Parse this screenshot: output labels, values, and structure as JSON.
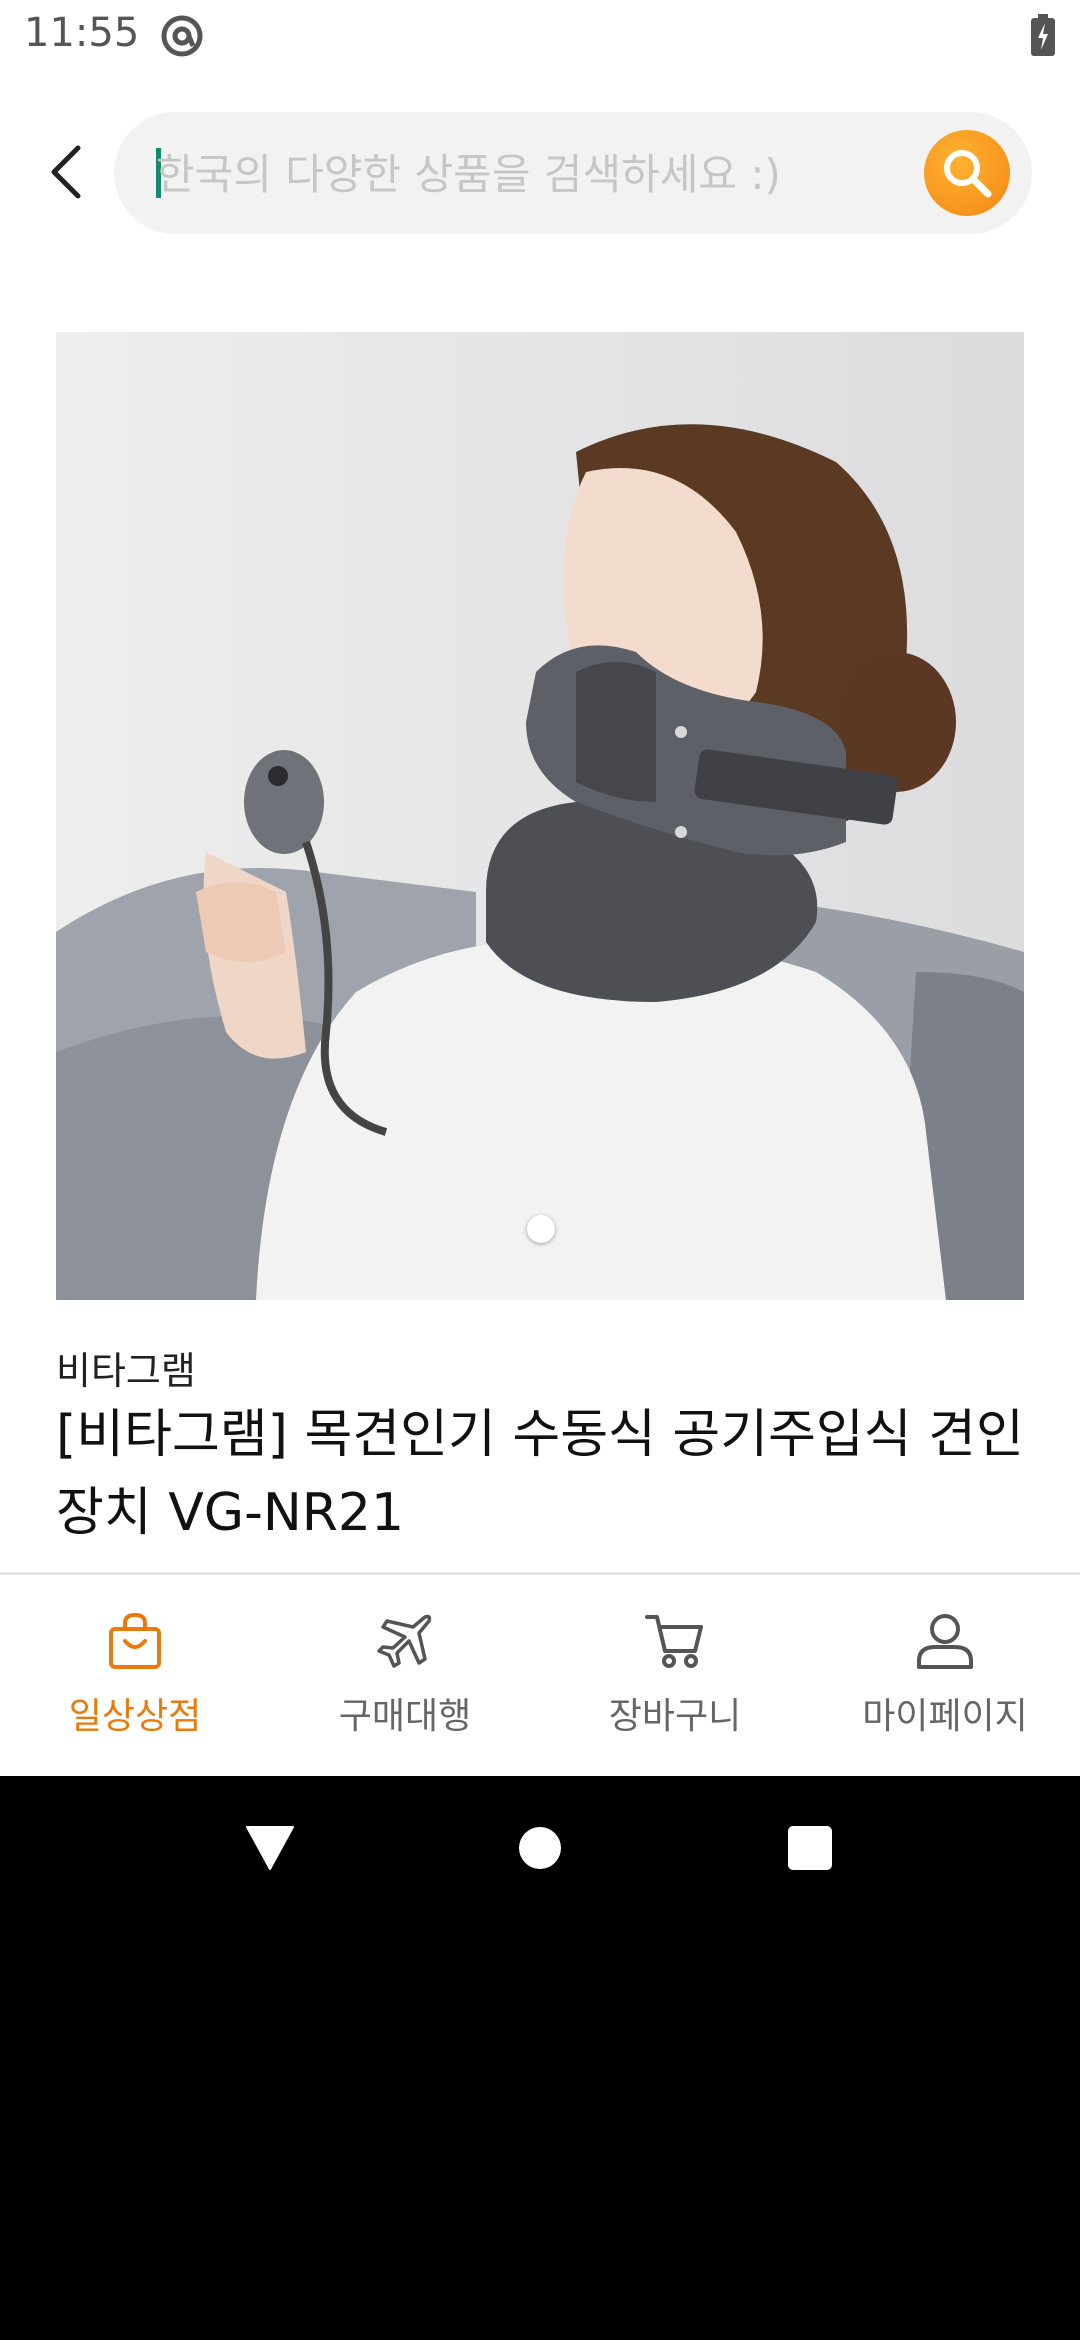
{
  "status_bar": {
    "time": "11:55"
  },
  "search": {
    "placeholder": "한국의 다양한 상품을 검색하세요 :)"
  },
  "product": {
    "brand": "비타그램",
    "title": "[비타그램] 목견인기 수동식 공기주입식 견인장치 VG-NR21"
  },
  "bottom_nav": {
    "items": [
      {
        "label": "일상상점",
        "icon": "shopping-bag-icon",
        "active": true
      },
      {
        "label": "구매대행",
        "icon": "airplane-icon",
        "active": false
      },
      {
        "label": "장바구니",
        "icon": "cart-icon",
        "active": false
      },
      {
        "label": "마이페이지",
        "icon": "person-icon",
        "active": false
      }
    ]
  },
  "colors": {
    "accent": "#ea7a0b",
    "search_button": "#f7941d",
    "caret": "#138a6d"
  }
}
